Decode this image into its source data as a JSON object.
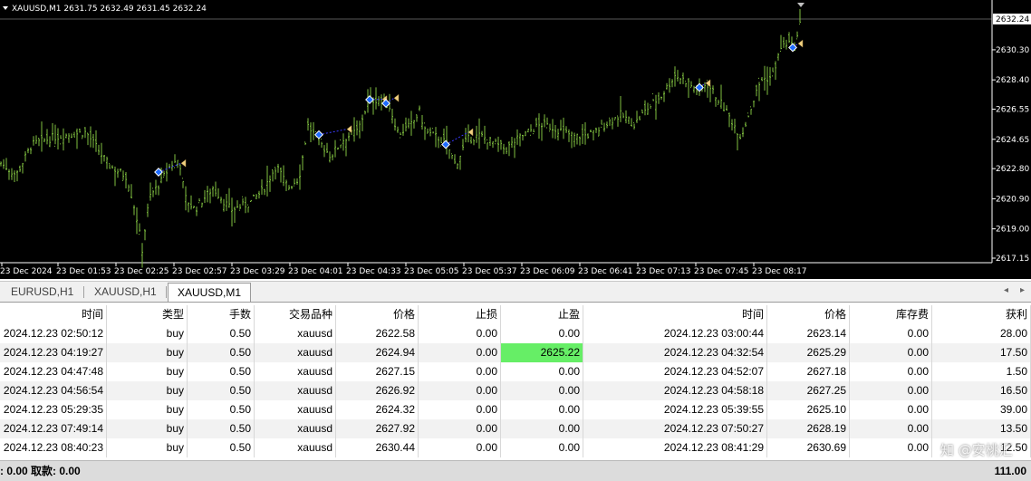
{
  "chart": {
    "symbol_info": "XAUUSD,M1  2631.75 2632.49 2631.45 2632.24",
    "current_price": "2632.24",
    "price_axis": [
      "2630.30",
      "2628.40",
      "2626.55",
      "2624.65",
      "2622.80",
      "2620.90",
      "2619.00",
      "2617.15"
    ],
    "time_axis": [
      "23 Dec 2024",
      "23 Dec 01:53",
      "23 Dec 02:25",
      "23 Dec 02:57",
      "23 Dec 03:29",
      "23 Dec 04:01",
      "23 Dec 04:33",
      "23 Dec 05:05",
      "23 Dec 05:37",
      "23 Dec 06:09",
      "23 Dec 06:41",
      "23 Dec 07:13",
      "23 Dec 07:45",
      "23 Dec 08:17"
    ],
    "bar_color": "#7fbf3f",
    "background_color": "#000000"
  },
  "tabs": [
    {
      "label": "EURUSD,H1"
    },
    {
      "label": "XAUUSD,H1"
    },
    {
      "label": "XAUUSD,M1"
    }
  ],
  "table": {
    "headers": [
      "时间",
      "类型",
      "手数",
      "交易品种",
      "价格",
      "止损",
      "止盈",
      "时间",
      "价格",
      "库存费",
      "获利"
    ],
    "rows": [
      [
        "2024.12.23 02:50:12",
        "buy",
        "0.50",
        "xauusd",
        "2622.58",
        "0.00",
        "0.00",
        "2024.12.23 03:00:44",
        "2623.14",
        "0.00",
        "28.00"
      ],
      [
        "2024.12.23 04:19:27",
        "buy",
        "0.50",
        "xauusd",
        "2624.94",
        "0.00",
        "2625.22",
        "2024.12.23 04:32:54",
        "2625.29",
        "0.00",
        "17.50"
      ],
      [
        "2024.12.23 04:47:48",
        "buy",
        "0.50",
        "xauusd",
        "2627.15",
        "0.00",
        "0.00",
        "2024.12.23 04:52:07",
        "2627.18",
        "0.00",
        "1.50"
      ],
      [
        "2024.12.23 04:56:54",
        "buy",
        "0.50",
        "xauusd",
        "2626.92",
        "0.00",
        "0.00",
        "2024.12.23 04:58:18",
        "2627.25",
        "0.00",
        "16.50"
      ],
      [
        "2024.12.23 05:29:35",
        "buy",
        "0.50",
        "xauusd",
        "2624.32",
        "0.00",
        "0.00",
        "2024.12.23 05:39:55",
        "2625.10",
        "0.00",
        "39.00"
      ],
      [
        "2024.12.23 07:49:14",
        "buy",
        "0.50",
        "xauusd",
        "2627.92",
        "0.00",
        "0.00",
        "2024.12.23 07:50:27",
        "2628.19",
        "0.00",
        "13.50"
      ],
      [
        "2024.12.23 08:40:23",
        "buy",
        "0.50",
        "xauusd",
        "2630.44",
        "0.00",
        "0.00",
        "2024.12.23 08:41:29",
        "2630.69",
        "0.00",
        "12.50"
      ]
    ]
  },
  "footer": {
    "left": ": 0.00  取款: 0.00",
    "right": "111.00"
  },
  "watermark": "知 @安桃汇"
}
